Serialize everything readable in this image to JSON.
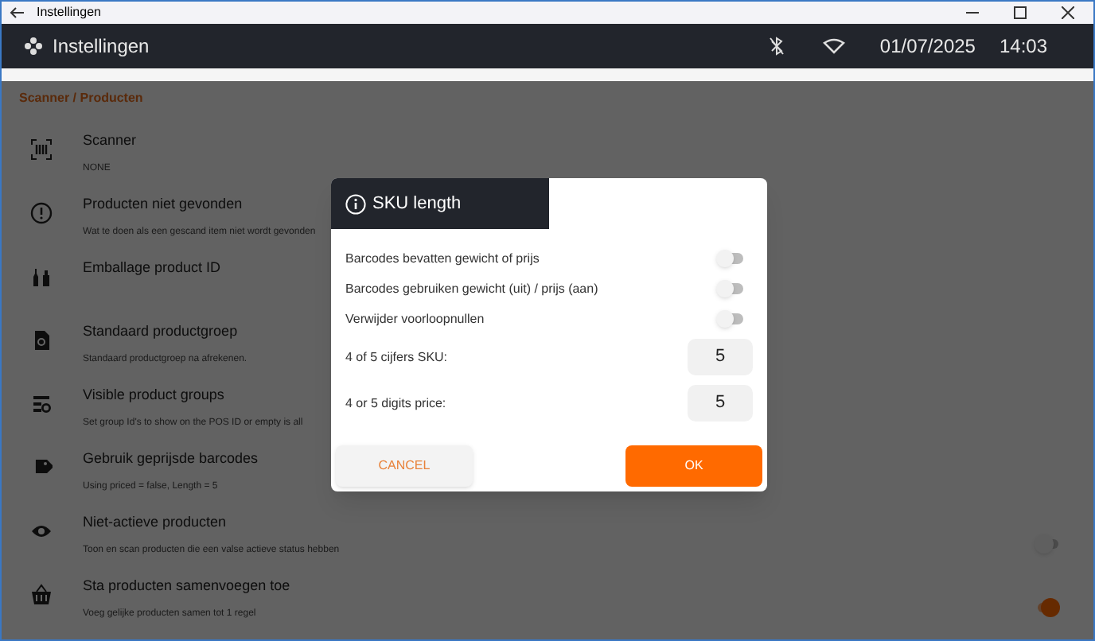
{
  "window": {
    "title": "Instellingen"
  },
  "app_bar": {
    "title": "Instellingen",
    "date": "01/07/2025",
    "time": "14:03"
  },
  "breadcrumb": "Scanner / Producten",
  "settings": [
    {
      "title": "Scanner",
      "description": "NONE"
    },
    {
      "title": "Producten niet gevonden",
      "description": "Wat te doen als een gescand item niet wordt gevonden"
    },
    {
      "title": "Emballage product ID"
    },
    {
      "title": "Standaard productgroep",
      "description": "Standaard productgroep na afrekenen."
    },
    {
      "title": "Visible product groups",
      "description": "Set group Id's to show on the POS ID or empty is all"
    },
    {
      "title": "Gebruik geprijsde barcodes",
      "description": "Using priced = false, Length = 5"
    },
    {
      "title": "Niet-actieve producten",
      "description": "Toon en scan producten die een valse actieve status hebben",
      "on": false
    },
    {
      "title": "Sta producten samenvoegen toe",
      "description": "Voeg gelijke producten samen tot 1 regel",
      "on": true
    }
  ],
  "dialog": {
    "title": "SKU length",
    "options": [
      {
        "kind": "toggle",
        "label": "Barcodes bevatten gewicht of prijs",
        "on": false
      },
      {
        "kind": "toggle",
        "label": "Barcodes gebruiken gewicht (uit) / prijs (aan)",
        "on": false
      },
      {
        "kind": "toggle",
        "label": "Verwijder voorloopnullen",
        "on": false
      },
      {
        "kind": "number",
        "label": "4 of 5 cijfers SKU:",
        "value": "5"
      },
      {
        "kind": "number",
        "label": "4 or 5 digits price:",
        "value": "5"
      }
    ],
    "buttons": [
      {
        "label": "CANCEL",
        "primary": false
      },
      {
        "label": "OK",
        "primary": true
      }
    ]
  }
}
